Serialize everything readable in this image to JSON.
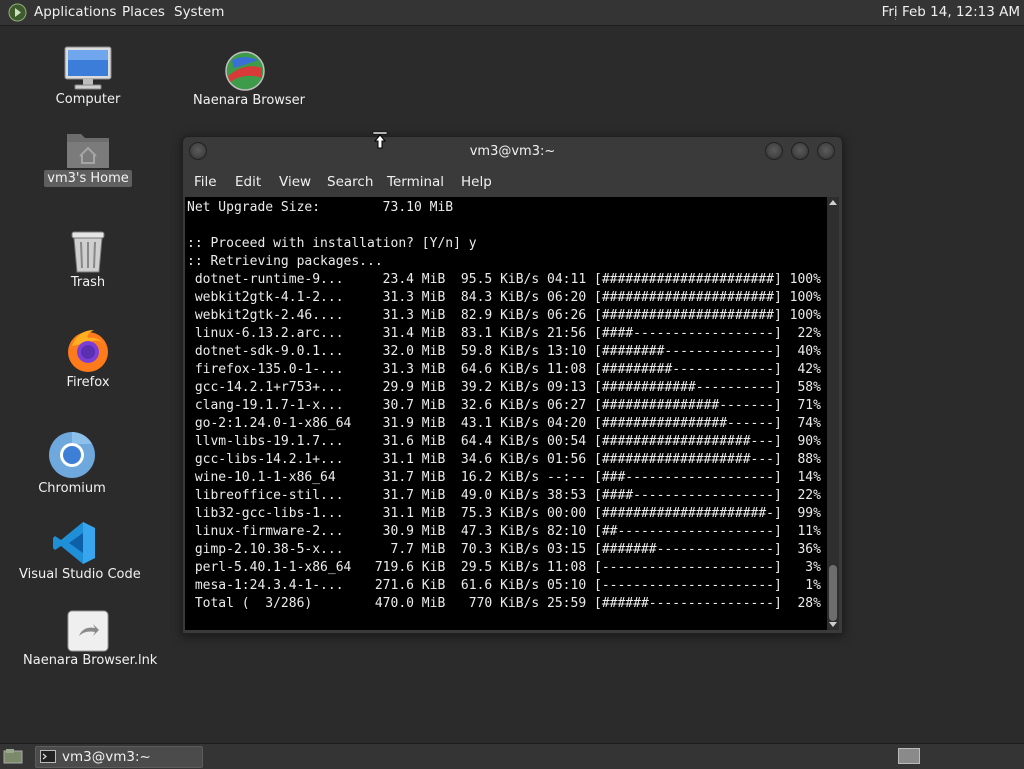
{
  "top_panel": {
    "menus": [
      "Applications",
      "Places",
      "System"
    ],
    "clock": "Fri Feb 14, 12:13 AM"
  },
  "desktop": {
    "icons": {
      "computer": "Computer",
      "browser": "Naenara Browser",
      "home": "vm3's Home",
      "trash": "Trash",
      "firefox": "Firefox",
      "chromium": "Chromium",
      "vscode": "Visual Studio Code",
      "browser_lnk": "Naenara Browser.lnk"
    }
  },
  "terminal": {
    "title": "vm3@vm3:~",
    "menu": [
      "File",
      "Edit",
      "View",
      "Search",
      "Terminal",
      "Help"
    ],
    "lines": [
      "Net Upgrade Size:        73.10 MiB",
      "",
      ":: Proceed with installation? [Y/n] y",
      ":: Retrieving packages...",
      " dotnet-runtime-9...     23.4 MiB  95.5 KiB/s 04:11 [######################] 100%",
      " webkit2gtk-4.1-2...     31.3 MiB  84.3 KiB/s 06:20 [######################] 100%",
      " webkit2gtk-2.46....     31.3 MiB  82.9 KiB/s 06:26 [######################] 100%",
      " linux-6.13.2.arc...     31.4 MiB  83.1 KiB/s 21:56 [####------------------]  22%",
      " dotnet-sdk-9.0.1...     32.0 MiB  59.8 KiB/s 13:10 [########--------------]  40%",
      " firefox-135.0-1-...     31.3 MiB  64.6 KiB/s 11:08 [#########-------------]  42%",
      " gcc-14.2.1+r753+...     29.9 MiB  39.2 KiB/s 09:13 [############----------]  58%",
      " clang-19.1.7-1-x...     30.7 MiB  32.6 KiB/s 06:27 [###############-------]  71%",
      " go-2:1.24.0-1-x86_64    31.9 MiB  43.1 KiB/s 04:20 [################------]  74%",
      " llvm-libs-19.1.7...     31.6 MiB  64.4 KiB/s 00:54 [###################---]  90%",
      " gcc-libs-14.2.1+...     31.1 MiB  34.6 KiB/s 01:56 [###################---]  88%",
      " wine-10.1-1-x86_64      31.7 MiB  16.2 KiB/s --:-- [###-------------------]  14%",
      " libreoffice-stil...     31.7 MiB  49.0 KiB/s 38:53 [####------------------]  22%",
      " lib32-gcc-libs-1...     31.1 MiB  75.3 KiB/s 00:00 [#####################-]  99%",
      " linux-firmware-2...     30.9 MiB  47.3 KiB/s 82:10 [##--------------------]  11%",
      " gimp-2.10.38-5-x...      7.7 MiB  70.3 KiB/s 03:15 [#######---------------]  36%",
      " perl-5.40.1-1-x86_64   719.6 KiB  29.5 KiB/s 11:08 [----------------------]   3%",
      " mesa-1:24.3.4-1-...    271.6 KiB  61.6 KiB/s 05:10 [----------------------]   1%",
      " Total (  3/286)        470.0 MiB   770 KiB/s 25:59 [######----------------]  28%"
    ]
  },
  "taskbar": {
    "task_label": "vm3@vm3:~"
  }
}
